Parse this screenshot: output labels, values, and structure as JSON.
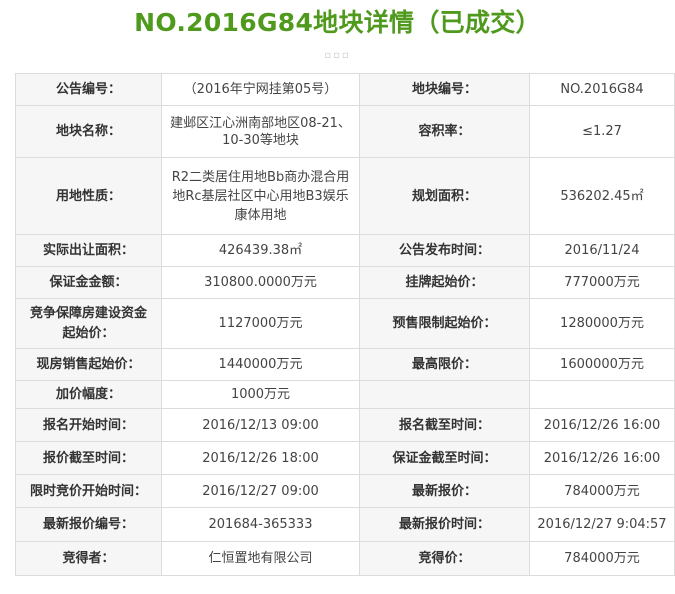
{
  "page": {
    "title": "NO.2016G84地块详情（已成交）",
    "divider": "▫▫▫"
  },
  "colors": {
    "title": "#4f9a1d",
    "start_price": "#4f9a1d",
    "final_price": "#c0392b",
    "border": "#dcdcdc",
    "label_bg": "#f6f6f6"
  },
  "rows": [
    {
      "k1": "公告编号：",
      "v1": "（2016年宁网挂第05号）",
      "k2": "地块编号：",
      "v2": "NO.2016G84"
    },
    {
      "k1": "地块名称：",
      "v1": "建邺区江心洲南部地区08-21、\n10-30等地块",
      "k2": "容积率：",
      "v2": "≤1.27"
    },
    {
      "k1": "用地性质：",
      "v1": "R2二类居住用地Bb商办混合用\n地Rc基层社区中心用地B3娱乐\n康体用地",
      "k2": "规划面积：",
      "v2": "536202.45㎡"
    },
    {
      "k1": "实际出让面积：",
      "v1": "426439.38㎡",
      "k2": "公告发布时间：",
      "v2": "2016/11/24"
    },
    {
      "k1": "保证金金额：",
      "v1": "310800.0000万元",
      "k2": "挂牌起始价：",
      "v2": "777000万元"
    },
    {
      "k1": "竞争保障房建设资金\n起始价：",
      "v1": "1127000万元",
      "k2": "预售限制起始价：",
      "v2": "1280000万元"
    },
    {
      "k1": "现房销售起始价：",
      "v1": "1440000万元",
      "k2": "最高限价：",
      "v2": "1600000万元"
    },
    {
      "k1": "加价幅度：",
      "v1": "1000万元",
      "k2": "",
      "v2": ""
    },
    {
      "k1": "报名开始时间：",
      "v1": "2016/12/13 09:00",
      "k2": "报名截至时间：",
      "v2": "2016/12/26 16:00"
    },
    {
      "k1": "报价截至时间：",
      "v1": "2016/12/26 18:00",
      "k2": "保证金截至时间：",
      "v2": "2016/12/26 16:00"
    },
    {
      "k1": "限时竞价开始时间：",
      "v1": "2016/12/27 09:00",
      "k2": "最新报价：",
      "v2": "784000万元"
    },
    {
      "k1": "最新报价编号：",
      "v1": "201684-365333",
      "k2": "最新报价时间：",
      "v2": "2016/12/27 9:04:57"
    },
    {
      "k1": "竞得者：",
      "v1": "仁恒置地有限公司",
      "k2": "竞得价：",
      "v2": "784000万元"
    }
  ]
}
